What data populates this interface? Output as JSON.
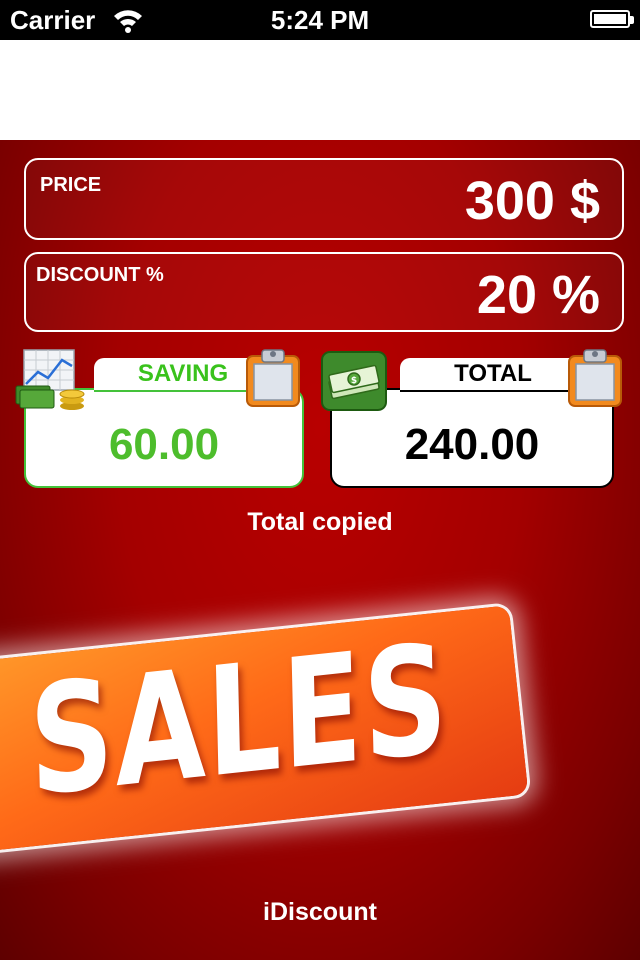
{
  "status_bar": {
    "carrier": "Carrier",
    "time": "5:24 PM"
  },
  "fields": {
    "price_label": "PRICE",
    "price_value": "300 $",
    "discount_label": "DISCOUNT %",
    "discount_value": "20 %"
  },
  "results": {
    "saving_label": "SAVING",
    "saving_value": "60.00",
    "total_label": "TOTAL",
    "total_value": "240.00"
  },
  "status_message": "Total copied",
  "banner_text": "SALES",
  "app_name": "iDiscount",
  "colors": {
    "background_red": "#a40000",
    "saving_green": "#4dbd2c",
    "banner_orange": "#ff7a1e"
  },
  "icons": [
    "wifi-icon",
    "battery-icon",
    "chart-coins-icon",
    "money-stack-icon",
    "clipboard-icon"
  ]
}
